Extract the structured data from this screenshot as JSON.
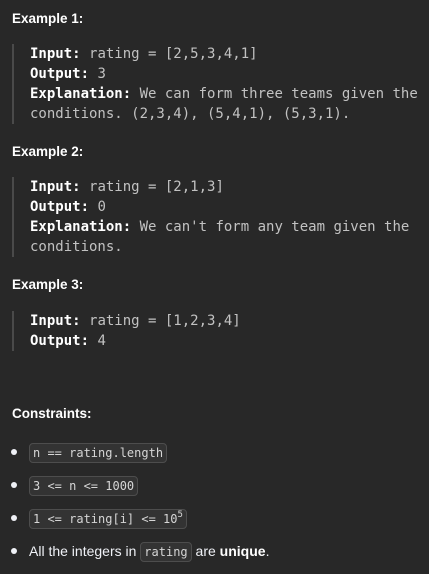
{
  "examples": [
    {
      "heading": "Example 1:",
      "input_label": "Input:",
      "input_value": "rating = [2,5,3,4,1]",
      "output_label": "Output:",
      "output_value": "3",
      "explanation_label": "Explanation:",
      "explanation_line1": "We can form three teams given the",
      "explanation_line2": "conditions. (2,3,4), (5,4,1), (5,3,1)."
    },
    {
      "heading": "Example 2:",
      "input_label": "Input:",
      "input_value": "rating = [2,1,3]",
      "output_label": "Output:",
      "output_value": "0",
      "explanation_label": "Explanation:",
      "explanation_line1": "We can't form any team given the",
      "explanation_line2": "conditions."
    },
    {
      "heading": "Example 3:",
      "input_label": "Input:",
      "input_value": "rating = [1,2,3,4]",
      "output_label": "Output:",
      "output_value": "4"
    }
  ],
  "constraints": {
    "heading": "Constraints:",
    "items": [
      {
        "code": "n == rating.length"
      },
      {
        "code": "3 <= n <= 1000"
      },
      {
        "code_base": "1 <= rating[i] <= 10",
        "code_sup": "5"
      },
      {
        "text_before": "All the integers in",
        "code": "rating",
        "text_middle": "are",
        "bold": "unique",
        "text_after": "."
      }
    ]
  }
}
